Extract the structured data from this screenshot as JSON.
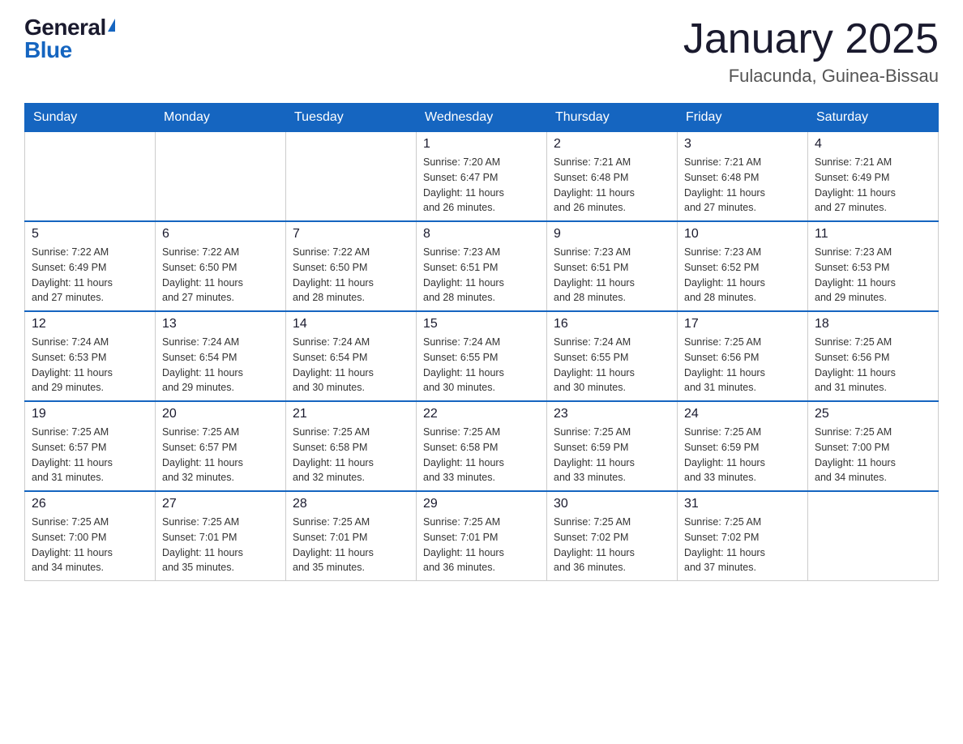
{
  "header": {
    "logo_general": "General",
    "logo_blue": "Blue",
    "month_title": "January 2025",
    "location": "Fulacunda, Guinea-Bissau"
  },
  "weekdays": [
    "Sunday",
    "Monday",
    "Tuesday",
    "Wednesday",
    "Thursday",
    "Friday",
    "Saturday"
  ],
  "weeks": [
    [
      {
        "day": "",
        "info": ""
      },
      {
        "day": "",
        "info": ""
      },
      {
        "day": "",
        "info": ""
      },
      {
        "day": "1",
        "info": "Sunrise: 7:20 AM\nSunset: 6:47 PM\nDaylight: 11 hours\nand 26 minutes."
      },
      {
        "day": "2",
        "info": "Sunrise: 7:21 AM\nSunset: 6:48 PM\nDaylight: 11 hours\nand 26 minutes."
      },
      {
        "day": "3",
        "info": "Sunrise: 7:21 AM\nSunset: 6:48 PM\nDaylight: 11 hours\nand 27 minutes."
      },
      {
        "day": "4",
        "info": "Sunrise: 7:21 AM\nSunset: 6:49 PM\nDaylight: 11 hours\nand 27 minutes."
      }
    ],
    [
      {
        "day": "5",
        "info": "Sunrise: 7:22 AM\nSunset: 6:49 PM\nDaylight: 11 hours\nand 27 minutes."
      },
      {
        "day": "6",
        "info": "Sunrise: 7:22 AM\nSunset: 6:50 PM\nDaylight: 11 hours\nand 27 minutes."
      },
      {
        "day": "7",
        "info": "Sunrise: 7:22 AM\nSunset: 6:50 PM\nDaylight: 11 hours\nand 28 minutes."
      },
      {
        "day": "8",
        "info": "Sunrise: 7:23 AM\nSunset: 6:51 PM\nDaylight: 11 hours\nand 28 minutes."
      },
      {
        "day": "9",
        "info": "Sunrise: 7:23 AM\nSunset: 6:51 PM\nDaylight: 11 hours\nand 28 minutes."
      },
      {
        "day": "10",
        "info": "Sunrise: 7:23 AM\nSunset: 6:52 PM\nDaylight: 11 hours\nand 28 minutes."
      },
      {
        "day": "11",
        "info": "Sunrise: 7:23 AM\nSunset: 6:53 PM\nDaylight: 11 hours\nand 29 minutes."
      }
    ],
    [
      {
        "day": "12",
        "info": "Sunrise: 7:24 AM\nSunset: 6:53 PM\nDaylight: 11 hours\nand 29 minutes."
      },
      {
        "day": "13",
        "info": "Sunrise: 7:24 AM\nSunset: 6:54 PM\nDaylight: 11 hours\nand 29 minutes."
      },
      {
        "day": "14",
        "info": "Sunrise: 7:24 AM\nSunset: 6:54 PM\nDaylight: 11 hours\nand 30 minutes."
      },
      {
        "day": "15",
        "info": "Sunrise: 7:24 AM\nSunset: 6:55 PM\nDaylight: 11 hours\nand 30 minutes."
      },
      {
        "day": "16",
        "info": "Sunrise: 7:24 AM\nSunset: 6:55 PM\nDaylight: 11 hours\nand 30 minutes."
      },
      {
        "day": "17",
        "info": "Sunrise: 7:25 AM\nSunset: 6:56 PM\nDaylight: 11 hours\nand 31 minutes."
      },
      {
        "day": "18",
        "info": "Sunrise: 7:25 AM\nSunset: 6:56 PM\nDaylight: 11 hours\nand 31 minutes."
      }
    ],
    [
      {
        "day": "19",
        "info": "Sunrise: 7:25 AM\nSunset: 6:57 PM\nDaylight: 11 hours\nand 31 minutes."
      },
      {
        "day": "20",
        "info": "Sunrise: 7:25 AM\nSunset: 6:57 PM\nDaylight: 11 hours\nand 32 minutes."
      },
      {
        "day": "21",
        "info": "Sunrise: 7:25 AM\nSunset: 6:58 PM\nDaylight: 11 hours\nand 32 minutes."
      },
      {
        "day": "22",
        "info": "Sunrise: 7:25 AM\nSunset: 6:58 PM\nDaylight: 11 hours\nand 33 minutes."
      },
      {
        "day": "23",
        "info": "Sunrise: 7:25 AM\nSunset: 6:59 PM\nDaylight: 11 hours\nand 33 minutes."
      },
      {
        "day": "24",
        "info": "Sunrise: 7:25 AM\nSunset: 6:59 PM\nDaylight: 11 hours\nand 33 minutes."
      },
      {
        "day": "25",
        "info": "Sunrise: 7:25 AM\nSunset: 7:00 PM\nDaylight: 11 hours\nand 34 minutes."
      }
    ],
    [
      {
        "day": "26",
        "info": "Sunrise: 7:25 AM\nSunset: 7:00 PM\nDaylight: 11 hours\nand 34 minutes."
      },
      {
        "day": "27",
        "info": "Sunrise: 7:25 AM\nSunset: 7:01 PM\nDaylight: 11 hours\nand 35 minutes."
      },
      {
        "day": "28",
        "info": "Sunrise: 7:25 AM\nSunset: 7:01 PM\nDaylight: 11 hours\nand 35 minutes."
      },
      {
        "day": "29",
        "info": "Sunrise: 7:25 AM\nSunset: 7:01 PM\nDaylight: 11 hours\nand 36 minutes."
      },
      {
        "day": "30",
        "info": "Sunrise: 7:25 AM\nSunset: 7:02 PM\nDaylight: 11 hours\nand 36 minutes."
      },
      {
        "day": "31",
        "info": "Sunrise: 7:25 AM\nSunset: 7:02 PM\nDaylight: 11 hours\nand 37 minutes."
      },
      {
        "day": "",
        "info": ""
      }
    ]
  ]
}
